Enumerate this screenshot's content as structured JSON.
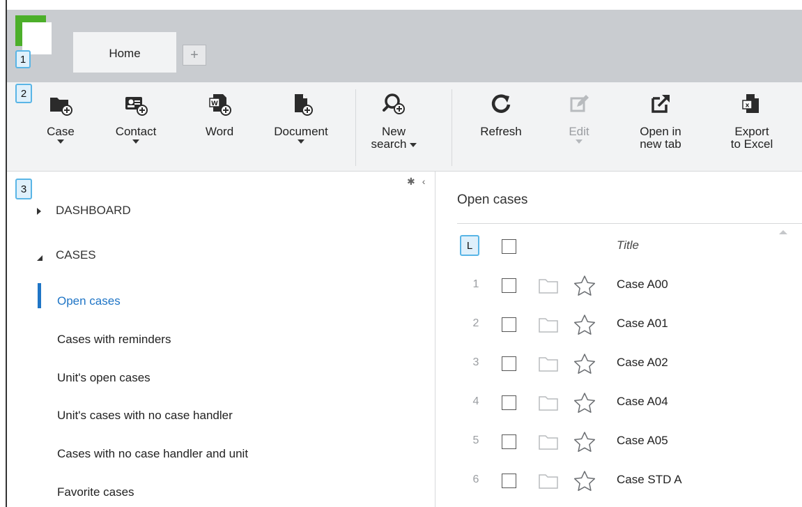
{
  "tabs": {
    "home_label": "Home",
    "add_label": "+"
  },
  "badges": [
    "1",
    "2",
    "3",
    "L"
  ],
  "ribbon": {
    "buttons": [
      {
        "label": "Case",
        "icon": "folder-add-icon",
        "has_menu": true
      },
      {
        "label": "Contact",
        "icon": "contact-card-add-icon",
        "has_menu": true
      },
      {
        "label": "Word",
        "icon": "word-document-add-icon",
        "has_menu": false
      },
      {
        "label": "Document",
        "icon": "document-add-icon",
        "has_menu": true
      },
      {
        "label": "New search",
        "label_line1": "New",
        "label_line2": "search",
        "icon": "search-add-icon",
        "has_menu": true
      },
      {
        "label": "Refresh",
        "icon": "refresh-icon",
        "has_menu": false
      },
      {
        "label": "Edit",
        "icon": "edit-icon",
        "has_menu": true,
        "disabled": true
      },
      {
        "label": "Open in new tab",
        "label_line1": "Open in",
        "label_line2": "new tab",
        "icon": "external-link-icon",
        "has_menu": false
      },
      {
        "label": "Export to Excel",
        "label_line1": "Export",
        "label_line2": "to Excel",
        "icon": "excel-export-icon",
        "has_menu": false
      }
    ]
  },
  "nav": {
    "sections": [
      {
        "label": "DASHBOARD",
        "expanded": false
      },
      {
        "label": "CASES",
        "expanded": true
      }
    ],
    "items": [
      {
        "label": "Open cases",
        "active": true
      },
      {
        "label": "Cases with reminders"
      },
      {
        "label": "Unit's open cases"
      },
      {
        "label": "Unit's cases with no case handler"
      },
      {
        "label": "Cases with no case handler and unit"
      },
      {
        "label": "Favorite cases"
      }
    ]
  },
  "list": {
    "title": "Open cases",
    "column_title": "Title",
    "rows": [
      {
        "num": "1",
        "title": "Case A00"
      },
      {
        "num": "2",
        "title": "Case A01"
      },
      {
        "num": "3",
        "title": "Case A02"
      },
      {
        "num": "4",
        "title": "Case A04"
      },
      {
        "num": "5",
        "title": "Case A05"
      },
      {
        "num": "6",
        "title": "Case STD A"
      }
    ]
  },
  "colors": {
    "accent": "#1f75c6",
    "logo_green": "#4caf2a",
    "tabbar_bg": "#c9ccd0",
    "ribbon_bg": "#f2f3f4",
    "badge_border": "#59b5e6"
  }
}
